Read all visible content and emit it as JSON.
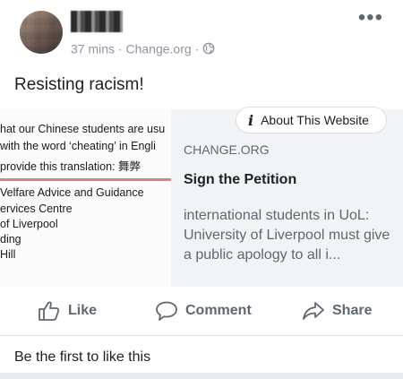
{
  "post": {
    "timestamp": "37 mins",
    "separator": "·",
    "source": "Change.org",
    "privacy_separator": "·",
    "privacy_icon": "globe-icon",
    "more_icon": "more-options-icon",
    "text": "Resisting racism!"
  },
  "link_card": {
    "image_text_lines": [
      "hat our Chinese students are usu",
      "with the word ‘cheating’ in Engli",
      "provide this translation: 舞弊",
      "Velfare Advice and Guidance",
      "ervices Centre",
      "of Liverpool",
      "ding",
      "Hill"
    ],
    "about_button_label": "About This Website",
    "domain": "CHANGE.ORG",
    "title": "Sign the Petition",
    "description": "international students in UoL: University of Liverpool must give a public apology to all i..."
  },
  "actions": {
    "like_label": "Like",
    "comment_label": "Comment",
    "share_label": "Share"
  },
  "likes_text": "Be the first to like this"
}
